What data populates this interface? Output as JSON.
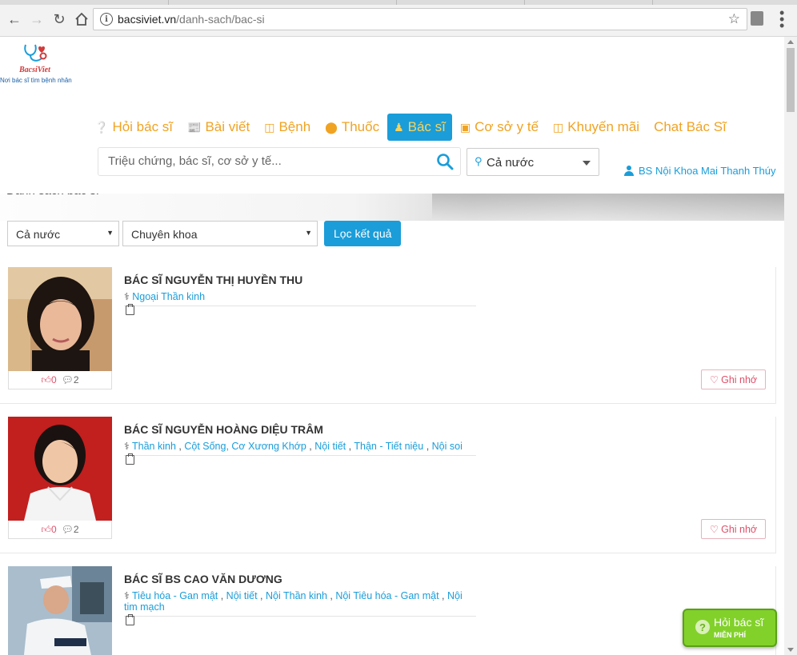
{
  "browser": {
    "url_host": "bacsiviet.vn",
    "url_path": "/danh-sach/bac-si"
  },
  "logo": {
    "brand": "BacsiViet",
    "tagline": "Nơi bác sĩ tìm bệnh nhân"
  },
  "nav": {
    "items": [
      {
        "label": "Hỏi bác sĩ",
        "icon": "question-circle-icon"
      },
      {
        "label": "Bài viết",
        "icon": "newspaper-icon"
      },
      {
        "label": "Bệnh",
        "icon": "bed-icon"
      },
      {
        "label": "Thuốc",
        "icon": "pill-icon"
      },
      {
        "label": "Bác sĩ",
        "icon": "doctor-icon"
      },
      {
        "label": "Cơ sở y tế",
        "icon": "hospital-icon"
      },
      {
        "label": "Khuyến mãi",
        "icon": "gift-icon"
      },
      {
        "label": "Chat Bác Sĩ",
        "icon": ""
      }
    ],
    "active_index": 4
  },
  "search": {
    "placeholder": "Triệu chứng, bác sĩ, cơ sở y tế...",
    "location": "Cả nước"
  },
  "user": {
    "name": "BS Nội Khoa Mai Thanh Thúy"
  },
  "banner": {
    "title": "Danh sách bác sĩ"
  },
  "filters": {
    "region": "Cả nước",
    "specialty": "Chuyên khoa",
    "submit": "Lọc kết quả"
  },
  "doctors": [
    {
      "name": "BÁC SĨ NGUYỄN THỊ HUYỀN THU",
      "specialties": [
        "Ngoại Thần kinh"
      ],
      "likes": "0",
      "comments": "2",
      "remember": "Ghi nhớ"
    },
    {
      "name": "BÁC SĨ NGUYỄN HOÀNG DIỆU TRÂM",
      "specialties": [
        "Thần kinh",
        "Cột Sống, Cơ Xương Khớp",
        "Nội tiết",
        "Thận - Tiết niệu",
        "Nội soi"
      ],
      "likes": "0",
      "comments": "2",
      "remember": "Ghi nhớ"
    },
    {
      "name": "BÁC SĨ BS CAO VĂN DƯƠNG",
      "specialties": [
        "Tiêu hóa - Gan mật",
        "Nội tiết",
        "Nội Thần kinh",
        "Nội Tiêu hóa - Gan mật",
        "Nội tim mạch"
      ],
      "likes": "",
      "comments": "",
      "remember": ""
    }
  ],
  "ask_button": {
    "line1": "Hỏi bác sĩ",
    "line2": "MIỄN PHÍ"
  },
  "colors": {
    "accent": "#1a9dd9",
    "nav_text": "#f0a323",
    "like": "#e0506a",
    "ask_green": "#82d12a"
  }
}
